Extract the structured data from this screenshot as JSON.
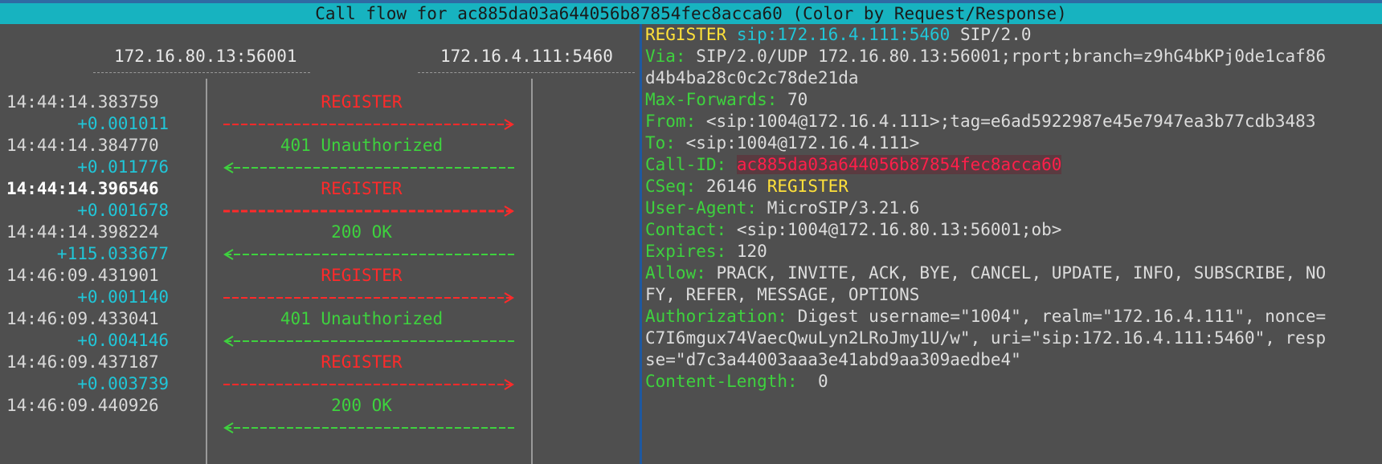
{
  "window": {
    "title": "Call flow for ac885da03a644056b87854fec8acca60 (Color by Request/Response)"
  },
  "flow": {
    "host_left": "172.16.80.13:56001",
    "host_right": "172.16.4.111:5460",
    "messages": [
      {
        "time": "14:44:14.383759",
        "delta": "+0.001011",
        "label": "REGISTER",
        "dir": "right",
        "color": "#ff2a2a",
        "selected": false
      },
      {
        "time": "14:44:14.384770",
        "delta": "+0.011776",
        "label": "401 Unauthorized",
        "dir": "left",
        "color": "#3ed23e",
        "selected": false
      },
      {
        "time": "14:44:14.396546",
        "delta": "+0.001678",
        "label": "REGISTER",
        "dir": "right",
        "color": "#ff2a2a",
        "selected": true
      },
      {
        "time": "14:44:14.398224",
        "delta": "+115.033677",
        "label": "200 OK",
        "dir": "left",
        "color": "#3ed23e",
        "selected": false
      },
      {
        "time": "14:46:09.431901",
        "delta": "+0.001140",
        "label": "REGISTER",
        "dir": "right",
        "color": "#ff2a2a",
        "selected": false
      },
      {
        "time": "14:46:09.433041",
        "delta": "+0.004146",
        "label": "401 Unauthorized",
        "dir": "left",
        "color": "#3ed23e",
        "selected": false
      },
      {
        "time": "14:46:09.437187",
        "delta": "+0.003739",
        "label": "REGISTER",
        "dir": "right",
        "color": "#ff2a2a",
        "selected": false
      },
      {
        "time": "14:46:09.440926",
        "delta": "",
        "label": "200 OK",
        "dir": "left",
        "color": "#3ed23e",
        "selected": false
      }
    ]
  },
  "detail": {
    "request_method": "REGISTER",
    "request_uri": "sip:172.16.4.111:5460",
    "request_version": "SIP/2.0",
    "via_name": "Via:",
    "via_value": "SIP/2.0/UDP 172.16.80.13:56001;rport;branch=z9hG4bKPj0de1caf86",
    "via_value_cont": "d4b4ba28c0c2c78de21da",
    "maxfwd_name": "Max-Forwards:",
    "maxfwd_value": "70",
    "from_name": "From:",
    "from_value": "<sip:1004@172.16.4.111>;tag=e6ad5922987e45e7947ea3b77cdb3483",
    "to_name": "To:",
    "to_value": "<sip:1004@172.16.4.111>",
    "callid_name": "Call-ID:",
    "callid_value": "ac885da03a644056b87854fec8acca60",
    "cseq_name": "CSeq:",
    "cseq_num": "26146",
    "cseq_method": "REGISTER",
    "ua_name": "User-Agent:",
    "ua_value": "MicroSIP/3.21.6",
    "contact_name": "Contact:",
    "contact_value": "<sip:1004@172.16.80.13:56001;ob>",
    "expires_name": "Expires:",
    "expires_value": "120",
    "allow_name": "Allow:",
    "allow_value": "PRACK, INVITE, ACK, BYE, CANCEL, UPDATE, INFO, SUBSCRIBE, NO",
    "allow_value_cont": "FY, REFER, MESSAGE, OPTIONS",
    "auth_name": "Authorization:",
    "auth_value": "Digest username=\"1004\", realm=\"172.16.4.111\", nonce=",
    "auth_value_cont1": "C7I6mgux74VaecQwuLyn2LRoJmy1U/w\", uri=\"sip:172.16.4.111:5460\", resp",
    "auth_value_cont2": "se=\"d7c3a44003aaa3e41abd9aa309aedbe4\"",
    "clen_name": "Content-Length:",
    "clen_value": " 0"
  }
}
